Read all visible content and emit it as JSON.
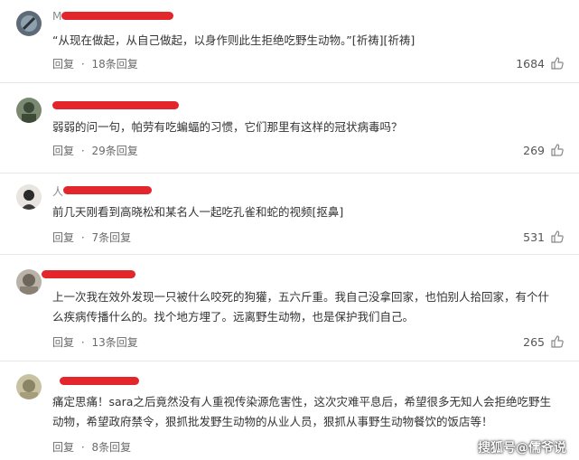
{
  "colors": {
    "redaction": "#e3262c",
    "separator": "#e6e6e6",
    "meta": "#6b6b6b"
  },
  "comments": [
    {
      "username": "M",
      "text": "“从现在做起，从自己做起，以身作则此生拒绝吃野生动物。”[祈祷][祈祷]",
      "reply_label": "回复",
      "reply_count": "18条回复",
      "likes": "1684"
    },
    {
      "username": "",
      "text": "弱弱的问一句，帕劳有吃蝙蝠的习惯，它们那里有这样的冠状病毒吗？",
      "reply_label": "回复",
      "reply_count": "29条回复",
      "likes": "269"
    },
    {
      "username": "人",
      "text": "前几天刚看到高晓松和某名人一起吃孔雀和蛇的视频[抠鼻]",
      "reply_label": "回复",
      "reply_count": "7条回复",
      "likes": "531"
    },
    {
      "username": "",
      "text": "上一次我在效外发现一只被什么咬死的狗獾，五六斤重。我自己没拿回家，也怕别人拾回家，有个什么疾病传播什么的。找个地方埋了。远离野生动物，也是保护我们自己。",
      "reply_label": "回复",
      "reply_count": "13条回复",
      "likes": "265"
    },
    {
      "username": "",
      "text": "痛定思痛！sara之后竟然没有人重视传染源危害性，这次灾难平息后，希望很多无知人会拒绝吃野生动物，希望政府禁令，狠抓批发野生动物的从业人员，狠抓从事野生动物餐饮的饭店等！",
      "reply_label": "回复",
      "reply_count": "8条回复",
      "likes": ""
    }
  ],
  "separator_dot": "·",
  "watermark": "搜狐号@儒爷说"
}
